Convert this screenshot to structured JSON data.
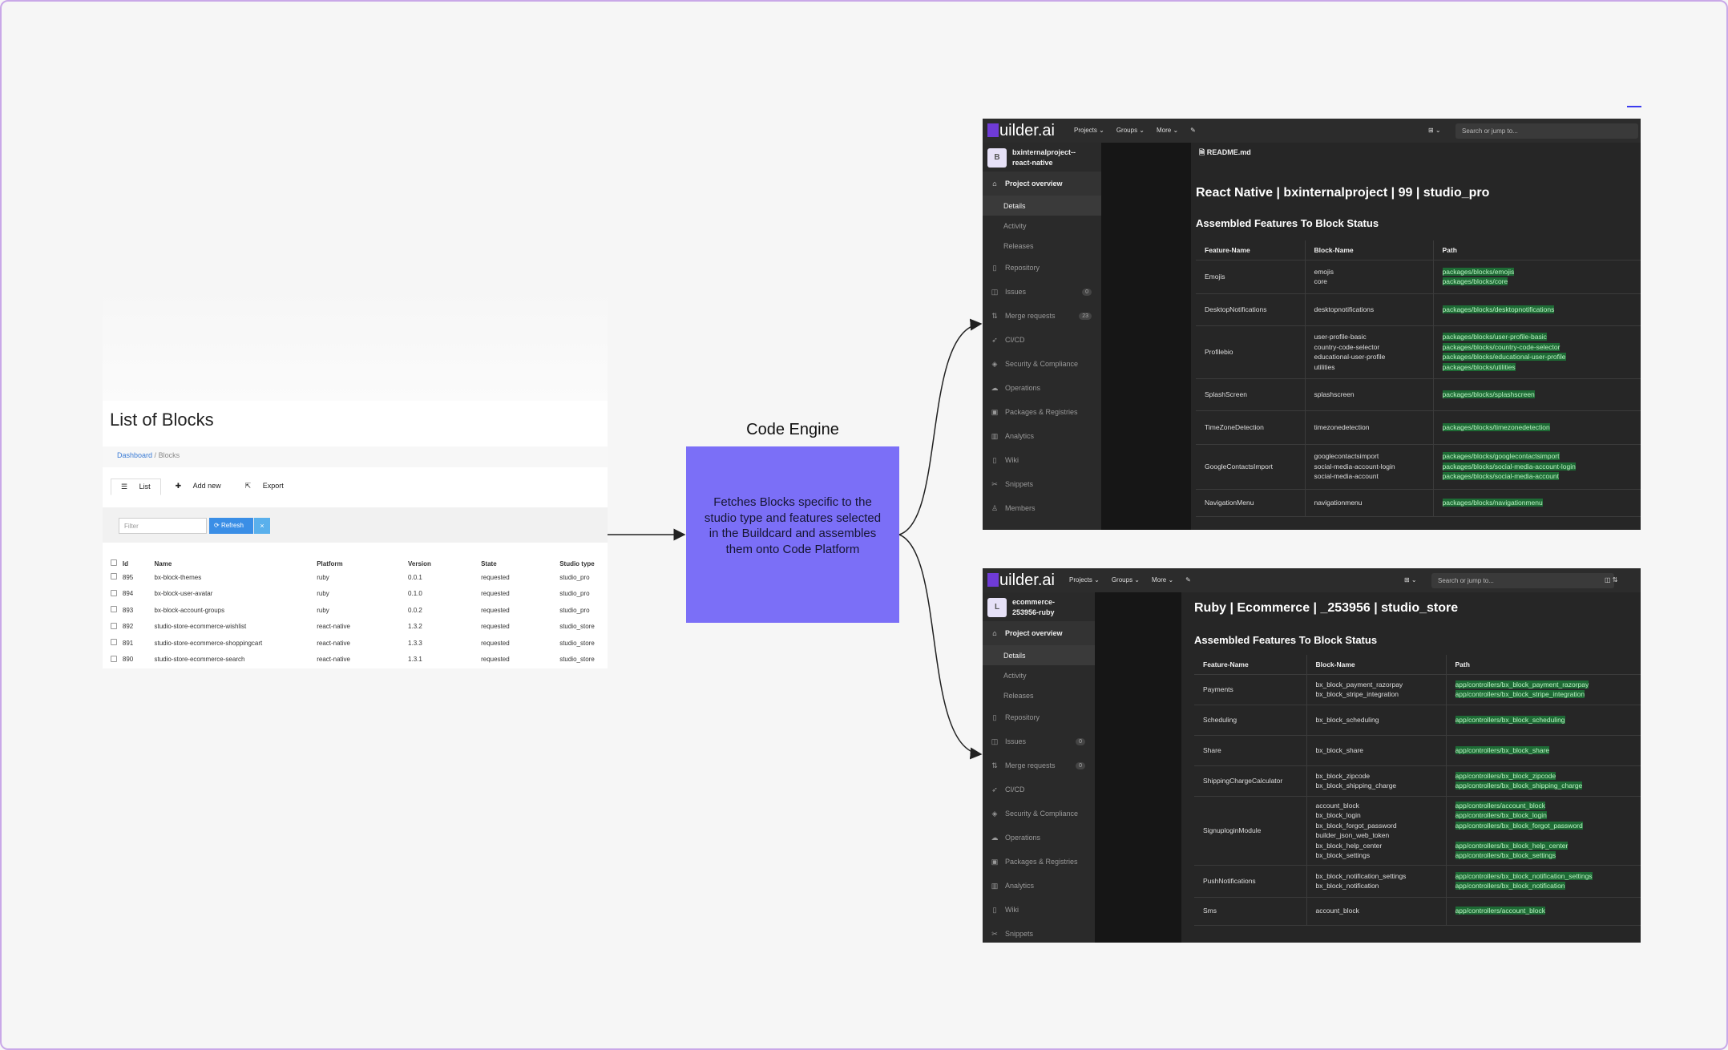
{
  "blocks_list": {
    "title": "List of Blocks",
    "breadcrumb": {
      "link": "Dashboard",
      "sep": "/",
      "current": "Blocks"
    },
    "tabs": {
      "list": "List",
      "add_new": "Add new",
      "export": "Export"
    },
    "filter_placeholder": "Filter",
    "refresh_label": "Refresh",
    "clear_label": "×",
    "columns": [
      "Id",
      "Name",
      "Platform",
      "Version",
      "State",
      "Studio type"
    ],
    "rows": [
      [
        "895",
        "bx-block-themes",
        "ruby",
        "0.0.1",
        "requested",
        "studio_pro"
      ],
      [
        "894",
        "bx-block-user-avatar",
        "ruby",
        "0.1.0",
        "requested",
        "studio_pro"
      ],
      [
        "893",
        "bx-block-account-groups",
        "ruby",
        "0.0.2",
        "requested",
        "studio_pro"
      ],
      [
        "892",
        "studio-store-ecommerce-wishlist",
        "react-native",
        "1.3.2",
        "requested",
        "studio_store"
      ],
      [
        "891",
        "studio-store-ecommerce-shoppingcart",
        "react-native",
        "1.3.3",
        "requested",
        "studio_store"
      ],
      [
        "890",
        "studio-store-ecommerce-search",
        "react-native",
        "1.3.1",
        "requested",
        "studio_store"
      ]
    ]
  },
  "engine": {
    "title": "Code Engine",
    "description": "Fetches Blocks specific to the studio type and features selected in the Buildcard and assembles them onto Code Platform"
  },
  "gitlab_top": {
    "logo_text": "uilder.ai",
    "nav": [
      "Projects ⌄",
      "Groups ⌄",
      "More ⌄"
    ],
    "search_placeholder": "Search or jump to...",
    "avatar_letter": "B",
    "project_name_1": "bxinternalproject--",
    "project_name_2": "react-native",
    "menu": [
      {
        "label": "Project overview",
        "icon": "⌂",
        "count": ""
      },
      {
        "label": "Details",
        "icon": "",
        "count": ""
      },
      {
        "label": "Activity",
        "icon": "",
        "count": ""
      },
      {
        "label": "Releases",
        "icon": "",
        "count": ""
      },
      {
        "label": "Repository",
        "icon": "▯",
        "count": ""
      },
      {
        "label": "Issues",
        "icon": "◫",
        "count": "0"
      },
      {
        "label": "Merge requests",
        "icon": "⇅",
        "count": "23"
      },
      {
        "label": "CI/CD",
        "icon": "➶",
        "count": ""
      },
      {
        "label": "Security & Compliance",
        "icon": "◈",
        "count": ""
      },
      {
        "label": "Operations",
        "icon": "☁",
        "count": ""
      },
      {
        "label": "Packages & Registries",
        "icon": "▣",
        "count": ""
      },
      {
        "label": "Analytics",
        "icon": "▥",
        "count": ""
      },
      {
        "label": "Wiki",
        "icon": "▯",
        "count": ""
      },
      {
        "label": "Snippets",
        "icon": "✂",
        "count": ""
      },
      {
        "label": "Members",
        "icon": "♙",
        "count": ""
      }
    ],
    "readme_label": "README.md",
    "heading": "React Native | bxinternalproject | 99 | studio_pro",
    "subheading": "Assembled Features To Block Status",
    "columns": [
      "Feature-Name",
      "Block-Name",
      "Path"
    ],
    "rows": [
      {
        "feature": "Emojis",
        "blocks": [
          "emojis",
          "core"
        ],
        "paths": [
          "packages/blocks/emojis",
          "packages/blocks/core"
        ]
      },
      {
        "feature": "DesktopNotifications",
        "blocks": [
          "desktopnotifications"
        ],
        "paths": [
          "packages/blocks/desktopnotifications"
        ]
      },
      {
        "feature": "Profilebio",
        "blocks": [
          "user-profile-basic",
          "country-code-selector",
          "educational-user-profile",
          "utilities"
        ],
        "paths": [
          "packages/blocks/user-profile-basic",
          "packages/blocks/country-code-selector",
          "packages/blocks/educational-user-profile",
          "packages/blocks/utilities"
        ]
      },
      {
        "feature": "SplashScreen",
        "blocks": [
          "splashscreen"
        ],
        "paths": [
          "packages/blocks/splashscreen"
        ]
      },
      {
        "feature": "TimeZoneDetection",
        "blocks": [
          "timezonedetection"
        ],
        "paths": [
          "packages/blocks/timezonedetection"
        ]
      },
      {
        "feature": "GoogleContactsImport",
        "blocks": [
          "googlecontactsimport",
          "social-media-account-login",
          "social-media-account"
        ],
        "paths": [
          "packages/blocks/googlecontactsimport",
          "packages/blocks/social-media-account-login",
          "packages/blocks/social-media-account"
        ]
      },
      {
        "feature": "NavigationMenu",
        "blocks": [
          "navigationmenu"
        ],
        "paths": [
          "packages/blocks/navigationmenu"
        ]
      }
    ]
  },
  "gitlab_bottom": {
    "logo_text": "uilder.ai",
    "nav": [
      "Projects ⌄",
      "Groups ⌄",
      "More ⌄"
    ],
    "search_placeholder": "Search or jump to...",
    "avatar_letter": "L",
    "project_name_1": "ecommerce-",
    "project_name_2": "253956-ruby",
    "menu": [
      {
        "label": "Project overview",
        "icon": "⌂",
        "count": ""
      },
      {
        "label": "Details",
        "icon": "",
        "count": ""
      },
      {
        "label": "Activity",
        "icon": "",
        "count": ""
      },
      {
        "label": "Releases",
        "icon": "",
        "count": ""
      },
      {
        "label": "Repository",
        "icon": "▯",
        "count": ""
      },
      {
        "label": "Issues",
        "icon": "◫",
        "count": "0"
      },
      {
        "label": "Merge requests",
        "icon": "⇅",
        "count": "0"
      },
      {
        "label": "CI/CD",
        "icon": "➶",
        "count": ""
      },
      {
        "label": "Security & Compliance",
        "icon": "◈",
        "count": ""
      },
      {
        "label": "Operations",
        "icon": "☁",
        "count": ""
      },
      {
        "label": "Packages & Registries",
        "icon": "▣",
        "count": ""
      },
      {
        "label": "Analytics",
        "icon": "▥",
        "count": ""
      },
      {
        "label": "Wiki",
        "icon": "▯",
        "count": ""
      },
      {
        "label": "Snippets",
        "icon": "✂",
        "count": ""
      }
    ],
    "heading": "Ruby | Ecommerce | _253956 | studio_store",
    "subheading": "Assembled Features To Block Status",
    "columns": [
      "Feature-Name",
      "Block-Name",
      "Path"
    ],
    "rows": [
      {
        "feature": "Payments",
        "blocks": [
          "bx_block_payment_razorpay",
          "bx_block_stripe_integration"
        ],
        "paths": [
          "app/controllers/bx_block_payment_razorpay",
          "app/controllers/bx_block_stripe_integration"
        ]
      },
      {
        "feature": "Scheduling",
        "blocks": [
          "bx_block_scheduling"
        ],
        "paths": [
          "app/controllers/bx_block_scheduling"
        ]
      },
      {
        "feature": "Share",
        "blocks": [
          "bx_block_share"
        ],
        "paths": [
          "app/controllers/bx_block_share"
        ]
      },
      {
        "feature": "ShippingChargeCalculator",
        "blocks": [
          "bx_block_zipcode",
          "bx_block_shipping_charge"
        ],
        "paths": [
          "app/controllers/bx_block_zipcode",
          "app/controllers/bx_block_shipping_charge"
        ]
      },
      {
        "feature": "SignuploginModule",
        "blocks": [
          "account_block",
          "bx_block_login",
          "bx_block_forgot_password",
          "builder_json_web_token",
          "bx_block_help_center",
          "bx_block_settings"
        ],
        "paths": [
          "app/controllers/account_block",
          "app/controllers/bx_block_login",
          "app/controllers/bx_block_forgot_password",
          "",
          "app/controllers/bx_block_help_center",
          "app/controllers/bx_block_settings"
        ]
      },
      {
        "feature": "PushNotifications",
        "blocks": [
          "bx_block_notification_settings",
          "bx_block_notification"
        ],
        "paths": [
          "app/controllers/bx_block_notification_settings",
          "app/controllers/bx_block_notification"
        ]
      },
      {
        "feature": "Sms",
        "blocks": [
          "account_block"
        ],
        "paths": [
          "app/controllers/account_block"
        ]
      }
    ]
  }
}
